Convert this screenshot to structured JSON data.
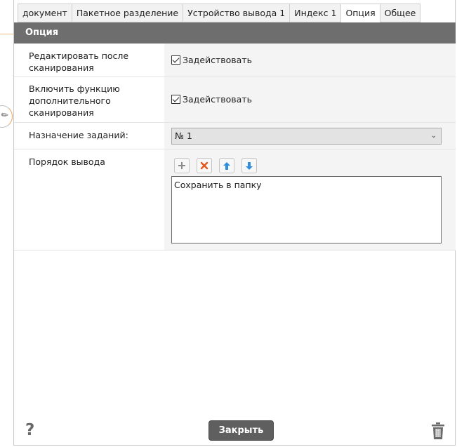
{
  "tabs": [
    {
      "label": "документ"
    },
    {
      "label": "Пакетное разделение"
    },
    {
      "label": "Устройство вывода 1"
    },
    {
      "label": "Индекс 1"
    },
    {
      "label": "Опция",
      "active": true
    },
    {
      "label": "Общее"
    }
  ],
  "section": {
    "title": "Опция"
  },
  "rows": {
    "edit_after_scan": {
      "label": "Редактировать после сканирования",
      "checkbox_label": "Задействовать",
      "checked": true
    },
    "additional_scan": {
      "label": "Включить функцию дополнительного сканирования",
      "checkbox_label": "Задействовать",
      "checked": true
    },
    "job_assignment": {
      "label": "Назначение заданий:",
      "selected": "№ 1"
    },
    "output_order": {
      "label": "Порядок вывода",
      "items": [
        "Сохранить в папку"
      ]
    }
  },
  "footer": {
    "help_glyph": "?",
    "close_label": "Закрыть"
  },
  "icons": {
    "add": "plus-icon",
    "delete": "x-icon",
    "move_up": "arrow-up-icon",
    "move_down": "arrow-down-icon",
    "trash": "trash-icon"
  },
  "colors": {
    "header_bg": "#6e6e6e",
    "close_bg": "#5f5f5f",
    "delete_icon": "#e2561b",
    "arrow_icon": "#2e8fe0"
  }
}
